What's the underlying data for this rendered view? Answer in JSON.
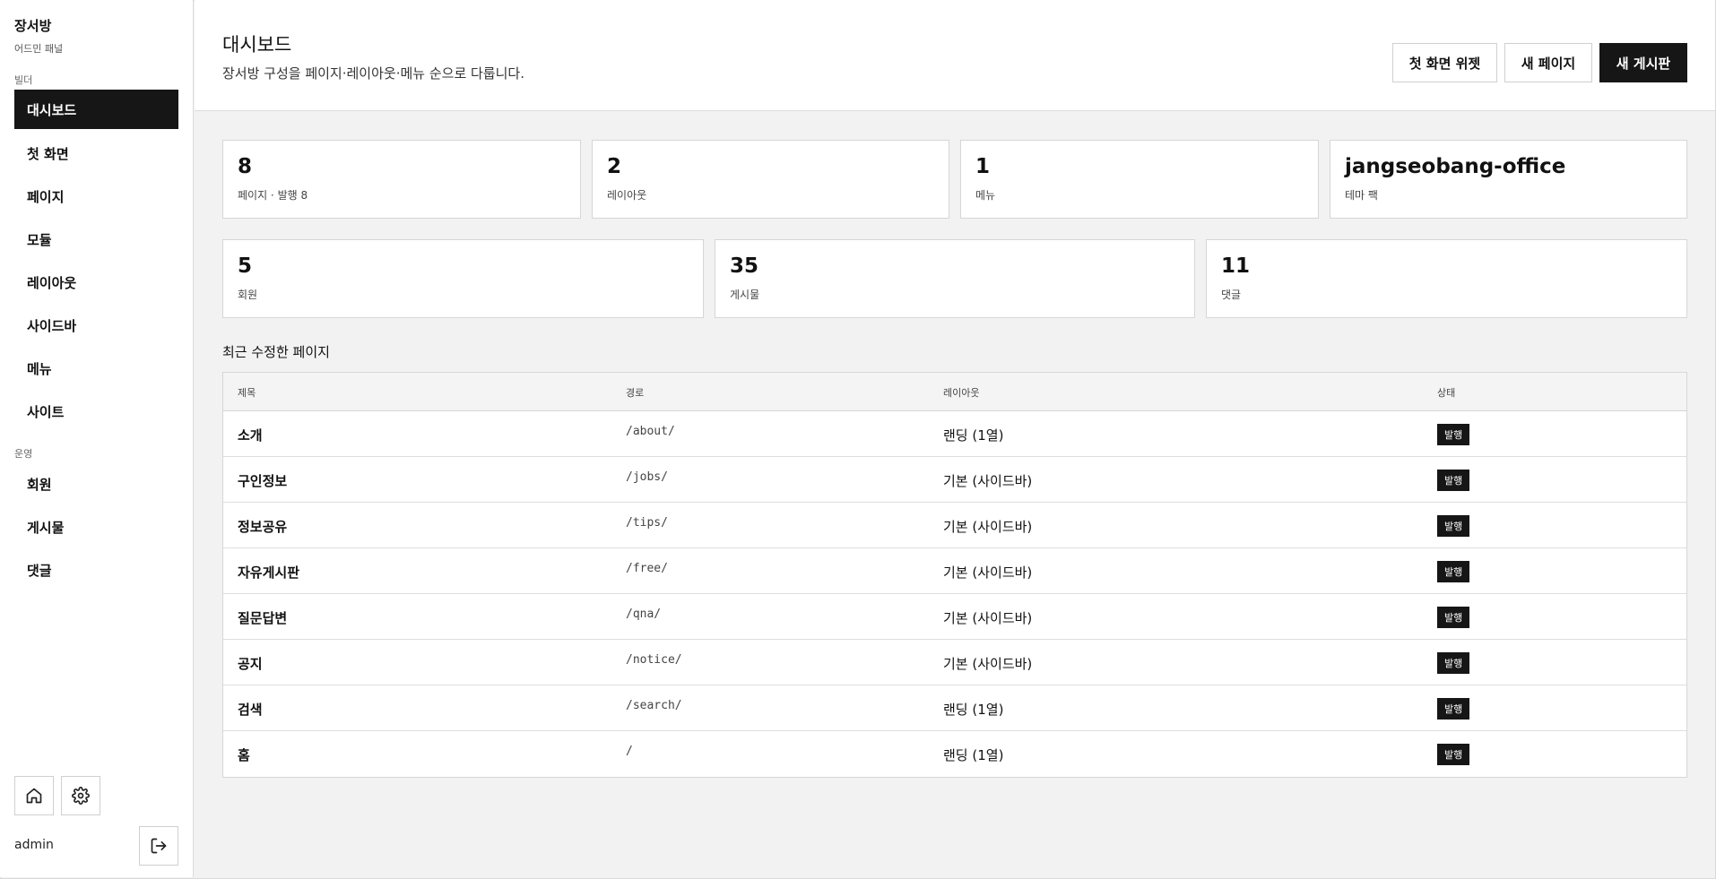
{
  "sidebar": {
    "brand_title": "장서방",
    "brand_sub": "어드민 패널",
    "section_builder": "빌더",
    "builder_items": [
      {
        "label": "대시보드"
      },
      {
        "label": "첫 화면"
      },
      {
        "label": "페이지"
      },
      {
        "label": "모듈"
      },
      {
        "label": "레이아웃"
      },
      {
        "label": "사이드바"
      },
      {
        "label": "메뉴"
      },
      {
        "label": "사이트"
      }
    ],
    "section_ops": "운영",
    "ops_items": [
      {
        "label": "회원"
      },
      {
        "label": "게시물"
      },
      {
        "label": "댓글"
      }
    ],
    "username": "admin",
    "icons": [
      "home-icon",
      "gear-icon",
      "logout-icon"
    ]
  },
  "header": {
    "title": "대시보드",
    "description": "장서방 구성을 페이지·레이아웃·메뉴 순으로 다룹니다.",
    "buttons": {
      "home_widget": "첫 화면 위젯",
      "new_page": "새 페이지",
      "new_board": "새 게시판"
    }
  },
  "stats_top": [
    {
      "value": "8",
      "label": "페이지 · 발행 8"
    },
    {
      "value": "2",
      "label": "레이아웃"
    },
    {
      "value": "1",
      "label": "메뉴"
    },
    {
      "value": "jangseobang-office",
      "label": "테마 팩"
    }
  ],
  "stats_bottom": [
    {
      "value": "5",
      "label": "회원"
    },
    {
      "value": "35",
      "label": "게시물"
    },
    {
      "value": "11",
      "label": "댓글"
    }
  ],
  "recent": {
    "title": "최근 수정한 페이지",
    "columns": {
      "title": "제목",
      "path": "경로",
      "layout": "레이아웃",
      "status": "상태"
    },
    "rows": [
      {
        "title": "소개",
        "path": "/about/",
        "layout": "랜딩 (1열)",
        "status": "발행"
      },
      {
        "title": "구인정보",
        "path": "/jobs/",
        "layout": "기본 (사이드바)",
        "status": "발행"
      },
      {
        "title": "정보공유",
        "path": "/tips/",
        "layout": "기본 (사이드바)",
        "status": "발행"
      },
      {
        "title": "자유게시판",
        "path": "/free/",
        "layout": "기본 (사이드바)",
        "status": "발행"
      },
      {
        "title": "질문답변",
        "path": "/qna/",
        "layout": "기본 (사이드바)",
        "status": "발행"
      },
      {
        "title": "공지",
        "path": "/notice/",
        "layout": "기본 (사이드바)",
        "status": "발행"
      },
      {
        "title": "검색",
        "path": "/search/",
        "layout": "랜딩 (1열)",
        "status": "발행"
      },
      {
        "title": "홈",
        "path": "/",
        "layout": "랜딩 (1열)",
        "status": "발행"
      }
    ]
  },
  "colors": {
    "accent": "#161616",
    "background": "#f2f2f2",
    "surface": "#ffffff",
    "border": "#d6d6d6"
  }
}
